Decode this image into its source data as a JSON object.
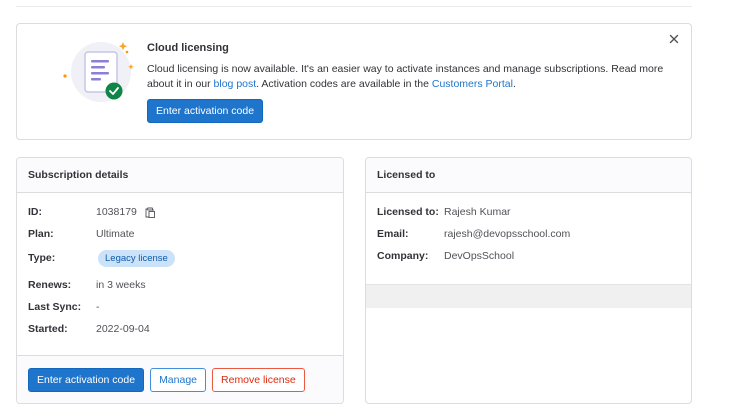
{
  "banner": {
    "title": "Cloud licensing",
    "text_before_blog": "Cloud licensing is now available. It's an easier way to activate instances and manage subscriptions. Read more about it in our ",
    "blog_link": "blog post",
    "text_middle": ". Activation codes are available in the ",
    "portal_link": "Customers Portal",
    "text_end": ".",
    "button_label": "Enter activation code",
    "close_icon": "close-icon"
  },
  "subscription": {
    "header": "Subscription details",
    "rows": [
      {
        "label": "ID:",
        "value": "1038179"
      },
      {
        "label": "Plan:",
        "value": "Ultimate"
      },
      {
        "label": "Type:",
        "value": "Legacy license"
      },
      {
        "label": "Renews:",
        "value": "in 3 weeks"
      },
      {
        "label": "Last Sync:",
        "value": "-"
      },
      {
        "label": "Started:",
        "value": "2022-09-04"
      }
    ],
    "buttons": {
      "activate": "Enter activation code",
      "manage": "Manage",
      "remove": "Remove license"
    }
  },
  "licensee": {
    "header": "Licensed to",
    "rows": [
      {
        "label": "Licensed to:",
        "value": "Rajesh Kumar"
      },
      {
        "label": "Email:",
        "value": "rajesh@devopsschool.com"
      },
      {
        "label": "Company:",
        "value": "DevOpsSchool"
      }
    ]
  },
  "colors": {
    "primary": "#1f75cb",
    "danger": "#dd2b0e",
    "badge_bg": "#cbe2f9",
    "success": "#108548"
  }
}
